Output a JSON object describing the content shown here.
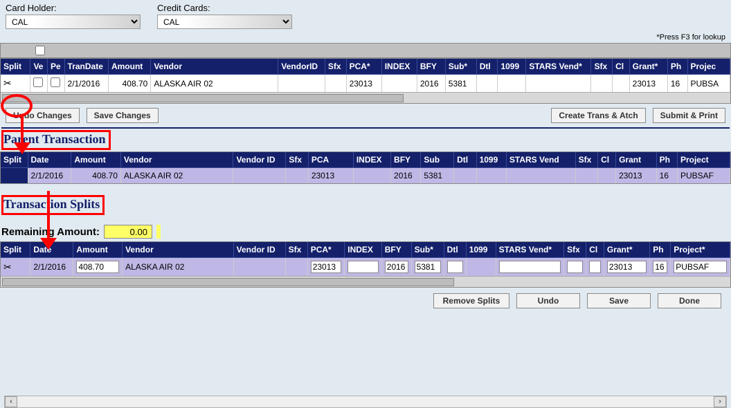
{
  "filters": {
    "card_holder_label": "Card Holder:",
    "card_holder_value": "CAL",
    "credit_cards_label": "Credit Cards:",
    "credit_cards_value": "CAL"
  },
  "lookup_hint": "*Press F3 for lookup",
  "main_grid": {
    "headers": [
      "Split",
      "Ve",
      "Pe",
      "TranDate",
      "Amount",
      "Vendor",
      "VendorID",
      "Sfx",
      "PCA*",
      "INDEX",
      "BFY",
      "Sub*",
      "Dtl",
      "1099",
      "STARS Vend*",
      "Sfx",
      "Cl",
      "Grant*",
      "Ph",
      "Projec"
    ],
    "row": {
      "tran_date": "2/1/2016",
      "amount": "408.70",
      "vendor": "ALASKA AIR 02",
      "pca": "23013",
      "bfy": "2016",
      "sub": "5381",
      "grant": "23013",
      "ph": "16",
      "project": "PUBSA"
    }
  },
  "buttons": {
    "undo_changes": "Undo Changes",
    "save_changes": "Save Changes",
    "create_trans_atch": "Create Trans & Atch",
    "submit_print": "Submit & Print",
    "remove_splits": "Remove Splits",
    "undo": "Undo",
    "save": "Save",
    "done": "Done"
  },
  "parent_section": {
    "title": "Parent Transaction",
    "headers": [
      "Split",
      "Date",
      "Amount",
      "Vendor",
      "Vendor ID",
      "Sfx",
      "PCA",
      "INDEX",
      "BFY",
      "Sub",
      "Dtl",
      "1099",
      "STARS Vend",
      "Sfx",
      "Cl",
      "Grant",
      "Ph",
      "Project"
    ],
    "row": {
      "date": "2/1/2016",
      "amount": "408.70",
      "vendor": "ALASKA AIR 02",
      "pca": "23013",
      "bfy": "2016",
      "sub": "5381",
      "grant": "23013",
      "ph": "16",
      "project": "PUBSAF"
    }
  },
  "splits_section": {
    "title": "Transaction Splits",
    "remaining_label": "Remaining Amount:",
    "remaining_value": "0.00",
    "headers": [
      "Split",
      "Date",
      "Amount",
      "Vendor",
      "Vendor ID",
      "Sfx",
      "PCA*",
      "INDEX",
      "BFY",
      "Sub*",
      "Dtl",
      "1099",
      "STARS Vend*",
      "Sfx",
      "Cl",
      "Grant*",
      "Ph",
      "Project*"
    ],
    "row": {
      "date": "2/1/2016",
      "amount": "408.70",
      "vendor": "ALASKA AIR 02",
      "pca": "23013",
      "index": "",
      "bfy": "2016",
      "sub": "5381",
      "dtl": "",
      "r1099": "",
      "stars_vend": "",
      "sfx2": "",
      "cl": "",
      "grant": "23013",
      "ph": "16",
      "project": "PUBSAF"
    }
  },
  "icons": {
    "scissors": "✂"
  },
  "scroll": {
    "left": "‹",
    "right": "›"
  }
}
